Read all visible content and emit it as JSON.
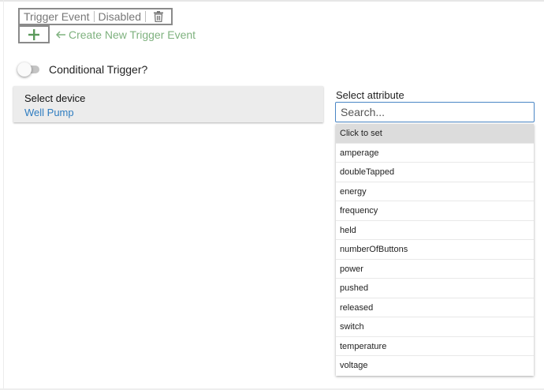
{
  "trigger": {
    "label": "Trigger Event",
    "status": "Disabled",
    "delete_icon": "trash-icon"
  },
  "create": {
    "add_icon": "plus-icon",
    "arrow_icon": "arrow-left-icon",
    "link_text": "Create New Trigger Event"
  },
  "conditional": {
    "label": "Conditional Trigger?",
    "enabled": false
  },
  "device": {
    "title": "Select device",
    "value": "Well Pump"
  },
  "attribute": {
    "label": "Select attribute",
    "search_placeholder": "Search...",
    "options": [
      "Click to set",
      "amperage",
      "doubleTapped",
      "energy",
      "frequency",
      "held",
      "numberOfButtons",
      "power",
      "pushed",
      "released",
      "switch",
      "temperature",
      "voltage"
    ]
  },
  "colors": {
    "link_green": "#7fb27f",
    "device_blue": "#2f7dc0",
    "focus_blue": "#4a86c5"
  }
}
